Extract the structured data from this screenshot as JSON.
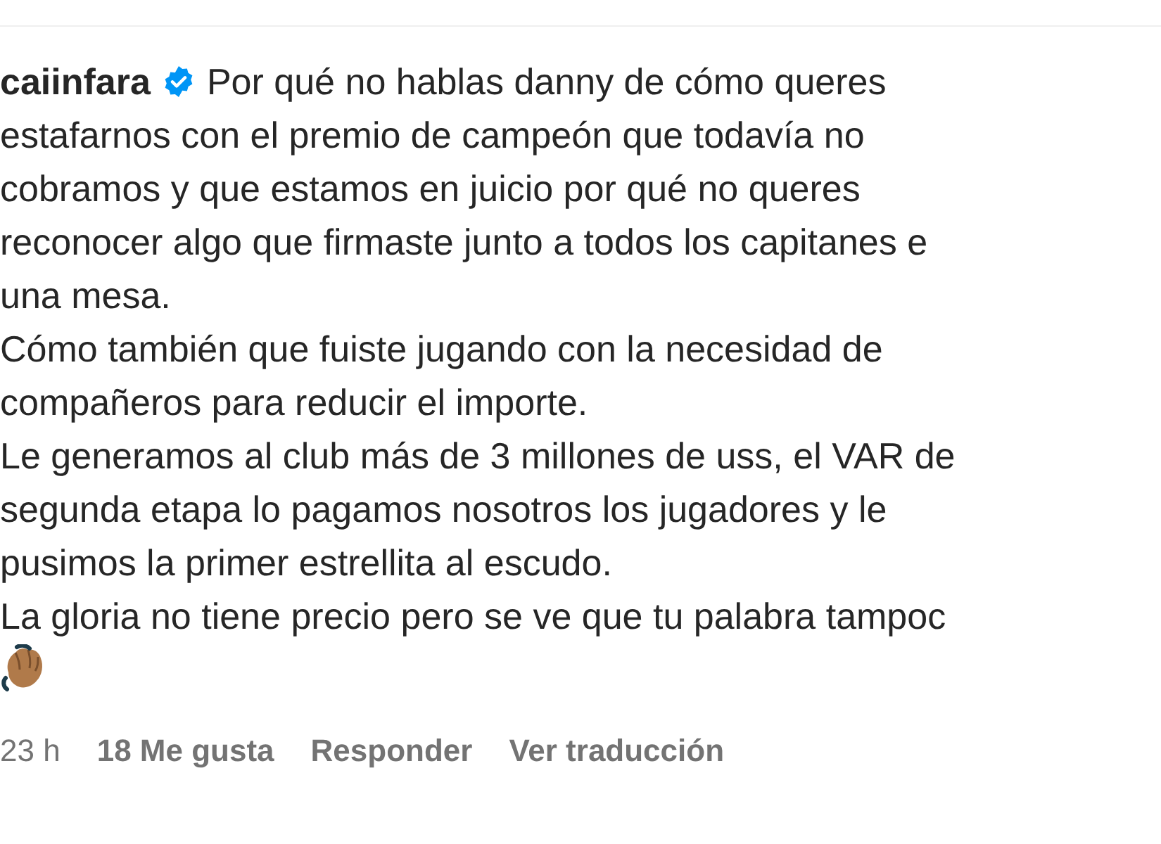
{
  "comment": {
    "username": "caiinfara",
    "verified": true,
    "lines": [
      "Por qué no hablas danny de cómo queres",
      "estafarnos con el premio de campeón que todavía no",
      "cobramos y que estamos en juicio por qué no queres",
      "reconocer algo que firmaste junto a todos los capitanes e",
      "una mesa.",
      "Cómo también que fuiste jugando con la necesidad de",
      "compañeros para reducir el importe.",
      "Le generamos al club más de 3 millones de uss, el VAR de",
      "segunda etapa lo pagamos nosotros los jugadores y le",
      "pusimos la primer estrellita al escudo.",
      "La gloria no tiene precio pero se ve que tu palabra tampoc"
    ],
    "time": "23 h",
    "likes": "18 Me gusta",
    "actions": [
      "Responder",
      "Ver traducción"
    ]
  }
}
